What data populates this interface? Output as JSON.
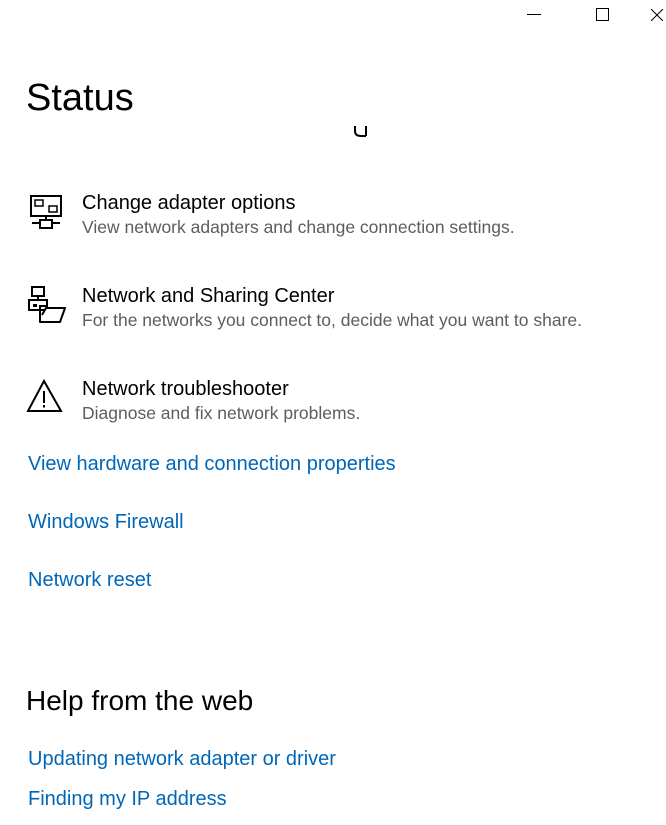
{
  "window": {
    "controls": {
      "minimize_icon": "minimize-icon",
      "maximize_icon": "maximize-icon",
      "close_icon": "close-icon"
    }
  },
  "header": {
    "title": "Status"
  },
  "actions": [
    {
      "title": "Change adapter options",
      "description": "View network adapters and change connection settings.",
      "icon": "network-adapter-icon"
    },
    {
      "title": "Network and Sharing Center",
      "description": "For the networks you connect to, decide what you want to share.",
      "icon": "sharing-center-icon"
    },
    {
      "title": "Network troubleshooter",
      "description": "Diagnose and fix network problems.",
      "icon": "warning-icon"
    }
  ],
  "links": [
    "View hardware and connection properties",
    "Windows Firewall",
    "Network reset"
  ],
  "help": {
    "heading": "Help from the web",
    "links": [
      "Updating network adapter or driver",
      "Finding my IP address"
    ]
  },
  "colors": {
    "link": "#0067b8",
    "description": "#5d5d5d",
    "background": "#ffffff"
  }
}
